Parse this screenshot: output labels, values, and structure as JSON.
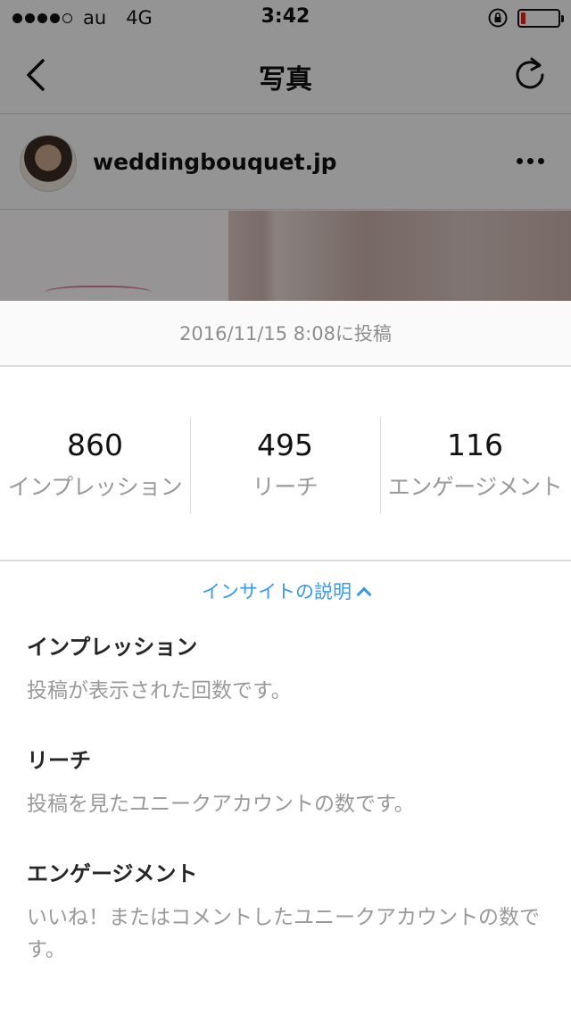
{
  "status_bar": {
    "carrier": "au",
    "network": "4G",
    "time": "3:42",
    "signal_bars_filled": 4,
    "signal_bars_total": 5,
    "battery_level": 0.12,
    "battery_color": "#e0221e"
  },
  "nav": {
    "title": "写真",
    "back_icon": "chevron-left-icon",
    "refresh_icon": "refresh-icon"
  },
  "post": {
    "username": "weddingbouquet.jp",
    "more_icon": "ellipsis-icon"
  },
  "insights": {
    "posted_at": "2016/11/15 8:08に投稿",
    "metrics": [
      {
        "value": "860",
        "label": "インプレッション"
      },
      {
        "value": "495",
        "label": "リーチ"
      },
      {
        "value": "116",
        "label": "エンゲージメント"
      }
    ],
    "toggle_label": "インサイトの説明",
    "definitions": [
      {
        "term": "インプレッション",
        "description": "投稿が表示された回数です。"
      },
      {
        "term": "リーチ",
        "description": "投稿を見たユニークアカウントの数です。"
      },
      {
        "term": "エンゲージメント",
        "description": "いいね！またはコメントしたユニークアカウントの数です。"
      }
    ],
    "accent_color": "#3897f0"
  }
}
